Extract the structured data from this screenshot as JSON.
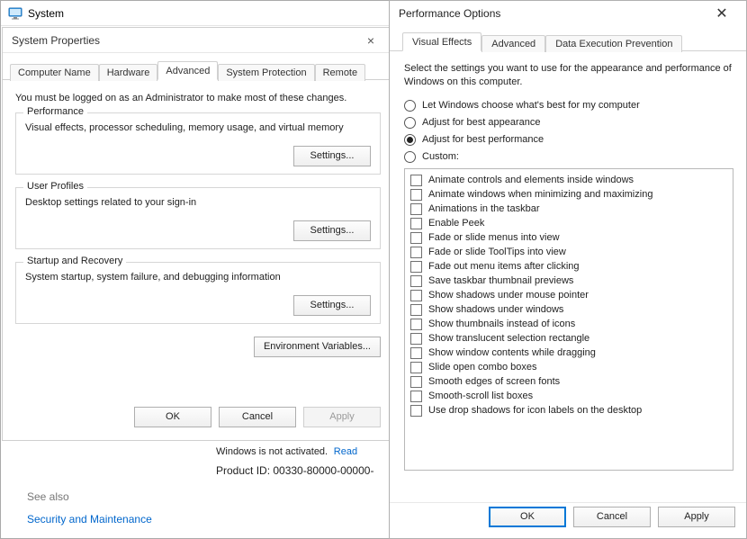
{
  "sys_window": {
    "title": "System"
  },
  "sp": {
    "title": "System Properties",
    "tabs": {
      "computer_name": "Computer Name",
      "hardware": "Hardware",
      "advanced": "Advanced",
      "system_protection": "System Protection",
      "remote": "Remote"
    },
    "intro": "You must be logged on as an Administrator to make most of these changes.",
    "perf": {
      "legend": "Performance",
      "desc": "Visual effects, processor scheduling, memory usage, and virtual memory",
      "btn": "Settings..."
    },
    "profiles": {
      "legend": "User Profiles",
      "desc": "Desktop settings related to your sign-in",
      "btn": "Settings..."
    },
    "startup": {
      "legend": "Startup and Recovery",
      "desc": "System startup, system failure, and debugging information",
      "btn": "Settings..."
    },
    "env_btn": "Environment Variables...",
    "ok": "OK",
    "cancel": "Cancel",
    "apply": "Apply"
  },
  "under": {
    "activation": "Windows is not activated.",
    "read": "Read",
    "pid": "Product ID: 00330-80000-00000-"
  },
  "see_also": "See also",
  "sec_maint": "Security and Maintenance",
  "po": {
    "title": "Performance Options",
    "tabs": {
      "visual_effects": "Visual Effects",
      "advanced": "Advanced",
      "dep": "Data Execution Prevention"
    },
    "intro": "Select the settings you want to use for the appearance and performance of Windows on this computer.",
    "radios": {
      "auto": "Let Windows choose what's best for my computer",
      "appearance": "Adjust for best appearance",
      "performance": "Adjust for best performance",
      "custom": "Custom:"
    },
    "selected_radio": "performance",
    "options": [
      "Animate controls and elements inside windows",
      "Animate windows when minimizing and maximizing",
      "Animations in the taskbar",
      "Enable Peek",
      "Fade or slide menus into view",
      "Fade or slide ToolTips into view",
      "Fade out menu items after clicking",
      "Save taskbar thumbnail previews",
      "Show shadows under mouse pointer",
      "Show shadows under windows",
      "Show thumbnails instead of icons",
      "Show translucent selection rectangle",
      "Show window contents while dragging",
      "Slide open combo boxes",
      "Smooth edges of screen fonts",
      "Smooth-scroll list boxes",
      "Use drop shadows for icon labels on the desktop"
    ],
    "ok": "OK",
    "cancel": "Cancel",
    "apply": "Apply"
  }
}
